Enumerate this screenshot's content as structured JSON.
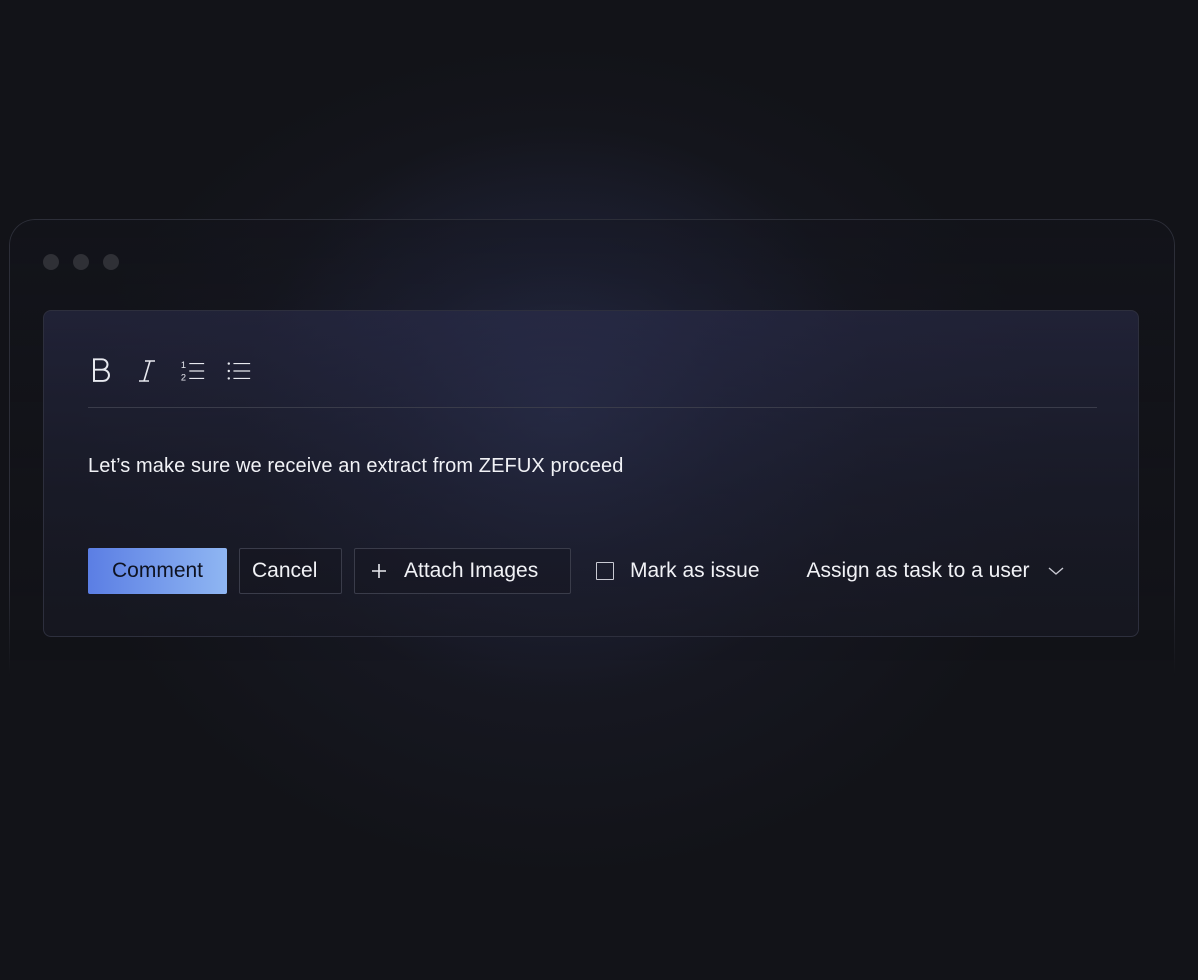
{
  "editor": {
    "toolbar": {
      "bold_icon": "bold-icon",
      "italic_icon": "italic-icon",
      "numbered_list_icon": "numbered-list-icon",
      "bullet_list_icon": "bullet-list-icon"
    },
    "comment_text": "Let’s make sure we receive an extract from ZEFUX proceed"
  },
  "actions": {
    "comment_label": "Comment",
    "cancel_label": "Cancel",
    "attach_label": "Attach Images",
    "mark_issue_label": "Mark as issue",
    "mark_issue_checked": false,
    "assign_label": "Assign as task to a user"
  },
  "colors": {
    "accent_start": "#5b7ee4",
    "accent_end": "#8fb6f2",
    "background": "#121318"
  }
}
